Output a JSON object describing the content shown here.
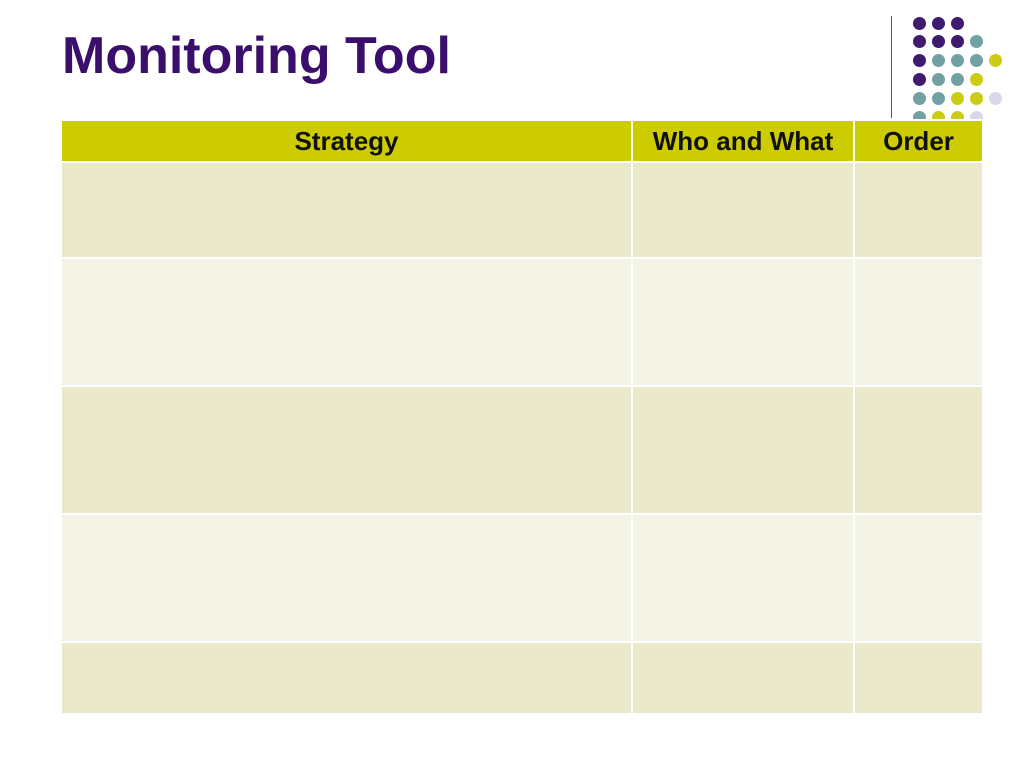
{
  "slide": {
    "title": "Monitoring Tool"
  },
  "table": {
    "headers": [
      "Strategy",
      "Who and What",
      "Order"
    ],
    "rows": [
      [
        "",
        "",
        ""
      ],
      [
        "",
        "",
        ""
      ],
      [
        "",
        "",
        ""
      ],
      [
        "",
        "",
        ""
      ],
      [
        "",
        "",
        ""
      ]
    ]
  },
  "theme": {
    "title_color": "#3a0f6b",
    "header_color": "#cccc00",
    "band_dark": "#eaeacb",
    "band_light": "#f4f4e6",
    "dot_purple": "#3e1b6e",
    "dot_teal": "#72a1a4",
    "dot_yellow": "#cccc14",
    "dot_lilac": "#d8d8ea"
  }
}
